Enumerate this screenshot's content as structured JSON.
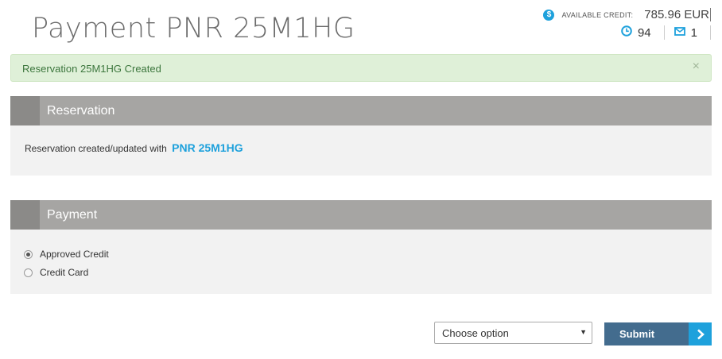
{
  "page": {
    "title": "Payment PNR 25M1HG"
  },
  "credit": {
    "icon": "dollar-circle-icon",
    "symbol": "$",
    "label": "AVAILABLE CREDIT:",
    "value": "785.96 EUR"
  },
  "stats": {
    "timer_icon": "clock-icon",
    "timer_value": "94",
    "messages_icon": "envelope-icon",
    "messages_value": "1"
  },
  "alert": {
    "text": "Reservation 25M1HG Created",
    "close": "×",
    "color": "#dff0d8"
  },
  "reservation": {
    "title": "Reservation",
    "text": "Reservation created/updated with",
    "pnr": "PNR 25M1HG"
  },
  "payment": {
    "title": "Payment",
    "options": [
      {
        "label": "Approved Credit",
        "selected": true
      },
      {
        "label": "Credit Card",
        "selected": false
      }
    ]
  },
  "form": {
    "select_value": "Choose option",
    "submit_label": "Submit"
  },
  "colors": {
    "accent": "#1ea1dc",
    "panel_header": "#a6a5a3",
    "submit": "#436c8e"
  }
}
